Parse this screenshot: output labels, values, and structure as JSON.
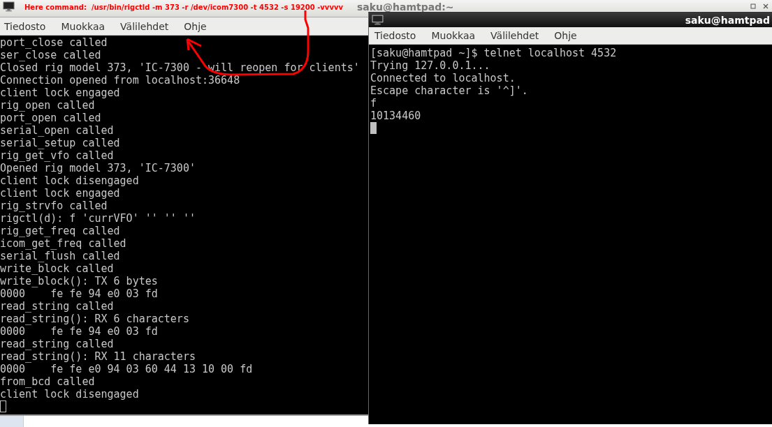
{
  "annotation": {
    "text": "Here command:  /usr/bin/rigctld -m 373 -r /dev/icom7300 -t 4532 -s 19200 -vvvvv"
  },
  "windows": [
    {
      "title": "saku@hamtpad:~",
      "focused": false,
      "menu": [
        "Tiedosto",
        "Muokkaa",
        "Välilehdet",
        "Ohje"
      ],
      "lines": [
        "port_close called",
        "ser_close called",
        "Closed rig model 373, 'IC-7300 - will reopen for clients'",
        "Connection opened from localhost:36648",
        "client lock engaged",
        "rig_open called",
        "port_open called",
        "serial_open called",
        "serial_setup called",
        "rig_get_vfo called",
        "Opened rig model 373, 'IC-7300'",
        "client lock disengaged",
        "client lock engaged",
        "rig_strvfo called",
        "rigctl(d): f 'currVFO' '' '' ''",
        "rig_get_freq called",
        "icom_get_freq called",
        "serial_flush called",
        "write_block called",
        "write_block(): TX 6 bytes",
        "0000    fe fe 94 e0 03 fd",
        "read_string called",
        "read_string(): RX 6 characters",
        "0000    fe fe 94 e0 03 fd",
        "read_string called",
        "read_string(): RX 11 characters",
        "0000    fe fe e0 94 03 60 44 13 10 00 fd",
        "from_bcd called",
        "client lock disengaged"
      ]
    },
    {
      "title": "saku@hamtpad",
      "focused": true,
      "menu": [
        "Tiedosto",
        "Muokkaa",
        "Välilehdet",
        "Ohje"
      ],
      "lines": [
        "[saku@hamtpad ~]$ telnet localhost 4532",
        "Trying 127.0.0.1...",
        "Connected to localhost.",
        "Escape character is '^]'.",
        "f",
        "10134460"
      ]
    }
  ]
}
